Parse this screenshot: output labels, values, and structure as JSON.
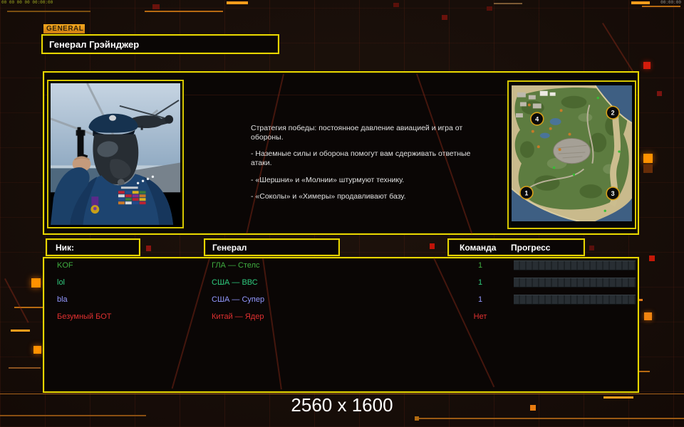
{
  "window": {
    "debug_left": "00 00 00 00 00:00:00",
    "debug_right": "00:00:00",
    "resolution_label": "2560 x 1600"
  },
  "header": {
    "tab_label": "GENERAL",
    "title": "Генерал Грэйнджер"
  },
  "briefing": {
    "lines": [
      "Стратегия победы: постоянное давление авиацией и игра от обороны.",
      "- Наземные силы и оборона помогут вам сдерживать ответные атаки.",
      "- «Шершни» и «Молнии» штурмуют технику.",
      "- «Соколы» и «Химеры» продавливают базу."
    ]
  },
  "map": {
    "markers": [
      "1",
      "2",
      "3",
      "4"
    ]
  },
  "players": {
    "headers": {
      "nick": "Ник:",
      "general": "Генерал",
      "team": "Команда",
      "progress": "Прогресс"
    },
    "rows": [
      {
        "nick": "KOF",
        "general": "ГЛА — Стелс",
        "team": "1",
        "color": "#3fae3f",
        "has_progress": true
      },
      {
        "nick": "lol",
        "general": "США — ВВС",
        "team": "1",
        "color": "#2ecb7e",
        "has_progress": true
      },
      {
        "nick": "bla",
        "general": "США — Супер",
        "team": "1",
        "color": "#9398ff",
        "has_progress": true
      },
      {
        "nick": "Безумный БОТ",
        "general": "Китай — Ядер",
        "team": "Нет",
        "color": "#e03030",
        "has_progress": false
      }
    ]
  },
  "colors": {
    "frame_yellow": "#e6d600",
    "circuit_orange": "#ff9100",
    "circuit_red": "#d41c0c",
    "line_orange": "#b76a12",
    "progress_bar_fill": "#262c30"
  }
}
